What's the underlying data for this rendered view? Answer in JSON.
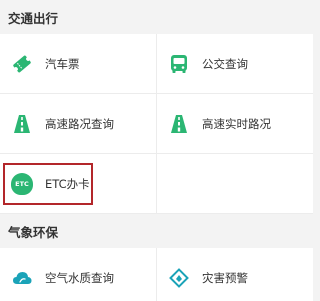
{
  "colors": {
    "accent": "#2bb673",
    "highlight": "#b3262a",
    "icon_teal": "#1aa3b8"
  },
  "sections": [
    {
      "title": "交通出行",
      "items": [
        {
          "label": "汽车票",
          "icon": "ticket-icon"
        },
        {
          "label": "公交查询",
          "icon": "bus-icon"
        },
        {
          "label": "高速路况查询",
          "icon": "highway-icon"
        },
        {
          "label": "高速实时路况",
          "icon": "highway-icon"
        },
        {
          "label": "ETC办卡",
          "icon": "etc-icon",
          "icon_text": "ETC"
        }
      ]
    },
    {
      "title": "气象环保",
      "items": [
        {
          "label": "空气水质查询",
          "icon": "cloud-icon"
        },
        {
          "label": "灾害预警",
          "icon": "warning-diamond-icon"
        }
      ]
    }
  ]
}
